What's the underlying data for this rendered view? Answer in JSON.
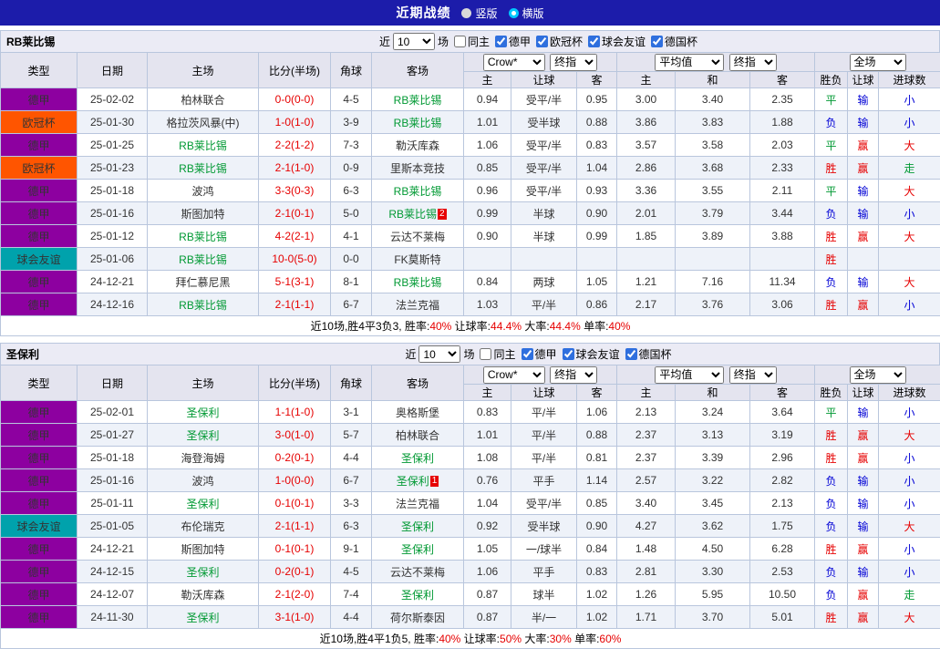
{
  "topbar": {
    "title": "近期战绩",
    "options": [
      {
        "label": "竖版",
        "selected": false
      },
      {
        "label": "横版",
        "selected": true
      }
    ]
  },
  "filter_labels": {
    "near": "近",
    "games": "场"
  },
  "table_header": {
    "type": "类型",
    "date": "日期",
    "home": "主场",
    "score": "比分(半场)",
    "corner": "角球",
    "away": "客场",
    "dd_company": "Crow*",
    "dd_final": "终指",
    "dd_average": "平均值",
    "dd_final2": "终指",
    "dd_fulltime": "全场",
    "ah_cols": [
      "主",
      "让球",
      "客"
    ],
    "eu_cols": [
      "主",
      "和",
      "客"
    ],
    "res_cols": [
      "胜负",
      "让球",
      "进球数"
    ]
  },
  "league_colors": {
    "德甲": "#8d00a0",
    "欧冠杯": "#ff5500",
    "球会友谊": "#00a2ac"
  },
  "colors": {
    "score": "#e60000",
    "subject_team": "#009933"
  },
  "result_colors": {
    "red": "#e60000",
    "blue": "#0000d5",
    "green": "#009933"
  },
  "result_color_map": {
    "胜": "red",
    "赢": "red",
    "大": "red",
    "负": "blue",
    "输": "blue",
    "小": "blue",
    "平": "green",
    "走": "green"
  },
  "sections": [
    {
      "team": "RB莱比锡",
      "filter": {
        "count": "10",
        "options": [
          {
            "label": "同主",
            "checked": false
          },
          {
            "label": "德甲",
            "checked": true
          },
          {
            "label": "欧冠杯",
            "checked": true
          },
          {
            "label": "球会友谊",
            "checked": true
          },
          {
            "label": "德国杯",
            "checked": true
          }
        ]
      },
      "rows": [
        {
          "league": "德甲",
          "date": "25-02-02",
          "home": "柏林联合",
          "home_subject": false,
          "score": "0-0(0-0)",
          "corner": "4-5",
          "away": "RB莱比锡",
          "away_subject": true,
          "ah": [
            "0.94",
            "受平/半",
            "0.95"
          ],
          "eu": [
            "3.00",
            "3.40",
            "2.35"
          ],
          "res": [
            "平",
            "输",
            "小"
          ]
        },
        {
          "league": "欧冠杯",
          "date": "25-01-30",
          "home": "格拉茨风暴(中)",
          "home_subject": false,
          "score": "1-0(1-0)",
          "corner": "3-9",
          "away": "RB莱比锡",
          "away_subject": true,
          "ah": [
            "1.01",
            "受半球",
            "0.88"
          ],
          "eu": [
            "3.86",
            "3.83",
            "1.88"
          ],
          "res": [
            "负",
            "输",
            "小"
          ]
        },
        {
          "league": "德甲",
          "date": "25-01-25",
          "home": "RB莱比锡",
          "home_subject": true,
          "score": "2-2(1-2)",
          "corner": "7-3",
          "away": "勒沃库森",
          "away_subject": false,
          "ah": [
            "1.06",
            "受平/半",
            "0.83"
          ],
          "eu": [
            "3.57",
            "3.58",
            "2.03"
          ],
          "res": [
            "平",
            "赢",
            "大"
          ]
        },
        {
          "league": "欧冠杯",
          "date": "25-01-23",
          "home": "RB莱比锡",
          "home_subject": true,
          "score": "2-1(1-0)",
          "corner": "0-9",
          "away": "里斯本竞技",
          "away_subject": false,
          "ah": [
            "0.85",
            "受平/半",
            "1.04"
          ],
          "eu": [
            "2.86",
            "3.68",
            "2.33"
          ],
          "res": [
            "胜",
            "赢",
            "走"
          ]
        },
        {
          "league": "德甲",
          "date": "25-01-18",
          "home": "波鸿",
          "home_subject": false,
          "score": "3-3(0-3)",
          "corner": "6-3",
          "away": "RB莱比锡",
          "away_subject": true,
          "ah": [
            "0.96",
            "受平/半",
            "0.93"
          ],
          "eu": [
            "3.36",
            "3.55",
            "2.11"
          ],
          "res": [
            "平",
            "输",
            "大"
          ]
        },
        {
          "league": "德甲",
          "date": "25-01-16",
          "home": "斯图加特",
          "home_subject": false,
          "score": "2-1(0-1)",
          "corner": "5-0",
          "away": "RB莱比锡",
          "away_subject": true,
          "away_redcard": "2",
          "ah": [
            "0.99",
            "半球",
            "0.90"
          ],
          "eu": [
            "2.01",
            "3.79",
            "3.44"
          ],
          "res": [
            "负",
            "输",
            "小"
          ]
        },
        {
          "league": "德甲",
          "date": "25-01-12",
          "home": "RB莱比锡",
          "home_subject": true,
          "score": "4-2(2-1)",
          "corner": "4-1",
          "away": "云达不莱梅",
          "away_subject": false,
          "ah": [
            "0.90",
            "半球",
            "0.99"
          ],
          "eu": [
            "1.85",
            "3.89",
            "3.88"
          ],
          "res": [
            "胜",
            "赢",
            "大"
          ]
        },
        {
          "league": "球会友谊",
          "date": "25-01-06",
          "home": "RB莱比锡",
          "home_subject": true,
          "score": "10-0(5-0)",
          "corner": "0-0",
          "away": "FK莫斯特",
          "away_subject": false,
          "ah": [
            "",
            "",
            ""
          ],
          "eu": [
            "",
            "",
            ""
          ],
          "res": [
            "胜",
            "",
            ""
          ]
        },
        {
          "league": "德甲",
          "date": "24-12-21",
          "home": "拜仁慕尼黑",
          "home_subject": false,
          "score": "5-1(3-1)",
          "corner": "8-1",
          "away": "RB莱比锡",
          "away_subject": true,
          "ah": [
            "0.84",
            "两球",
            "1.05"
          ],
          "eu": [
            "1.21",
            "7.16",
            "11.34"
          ],
          "res": [
            "负",
            "输",
            "大"
          ]
        },
        {
          "league": "德甲",
          "date": "24-12-16",
          "home": "RB莱比锡",
          "home_subject": true,
          "score": "2-1(1-1)",
          "corner": "6-7",
          "away": "法兰克福",
          "away_subject": false,
          "ah": [
            "1.03",
            "平/半",
            "0.86"
          ],
          "eu": [
            "2.17",
            "3.76",
            "3.06"
          ],
          "res": [
            "胜",
            "赢",
            "小"
          ]
        }
      ],
      "summary": {
        "prefix": "近10场,胜4平3负3,",
        "stats": [
          {
            "label": "胜率:",
            "value": "40%"
          },
          {
            "label": "让球率:",
            "value": "44.4%"
          },
          {
            "label": "大率:",
            "value": "44.4%"
          },
          {
            "label": "单率:",
            "value": "40%"
          }
        ]
      }
    },
    {
      "team": "圣保利",
      "filter": {
        "count": "10",
        "options": [
          {
            "label": "同主",
            "checked": false
          },
          {
            "label": "德甲",
            "checked": true
          },
          {
            "label": "球会友谊",
            "checked": true
          },
          {
            "label": "德国杯",
            "checked": true
          }
        ]
      },
      "rows": [
        {
          "league": "德甲",
          "date": "25-02-01",
          "home": "圣保利",
          "home_subject": true,
          "score": "1-1(1-0)",
          "corner": "3-1",
          "away": "奥格斯堡",
          "away_subject": false,
          "ah": [
            "0.83",
            "平/半",
            "1.06"
          ],
          "eu": [
            "2.13",
            "3.24",
            "3.64"
          ],
          "res": [
            "平",
            "输",
            "小"
          ]
        },
        {
          "league": "德甲",
          "date": "25-01-27",
          "home": "圣保利",
          "home_subject": true,
          "score": "3-0(1-0)",
          "corner": "5-7",
          "away": "柏林联合",
          "away_subject": false,
          "ah": [
            "1.01",
            "平/半",
            "0.88"
          ],
          "eu": [
            "2.37",
            "3.13",
            "3.19"
          ],
          "res": [
            "胜",
            "赢",
            "大"
          ]
        },
        {
          "league": "德甲",
          "date": "25-01-18",
          "home": "海登海姆",
          "home_subject": false,
          "score": "0-2(0-1)",
          "corner": "4-4",
          "away": "圣保利",
          "away_subject": true,
          "ah": [
            "1.08",
            "平/半",
            "0.81"
          ],
          "eu": [
            "2.37",
            "3.39",
            "2.96"
          ],
          "res": [
            "胜",
            "赢",
            "小"
          ]
        },
        {
          "league": "德甲",
          "date": "25-01-16",
          "home": "波鸿",
          "home_subject": false,
          "score": "1-0(0-0)",
          "corner": "6-7",
          "away": "圣保利",
          "away_subject": true,
          "away_redcard": "1",
          "ah": [
            "0.76",
            "平手",
            "1.14"
          ],
          "eu": [
            "2.57",
            "3.22",
            "2.82"
          ],
          "res": [
            "负",
            "输",
            "小"
          ]
        },
        {
          "league": "德甲",
          "date": "25-01-11",
          "home": "圣保利",
          "home_subject": true,
          "score": "0-1(0-1)",
          "corner": "3-3",
          "away": "法兰克福",
          "away_subject": false,
          "ah": [
            "1.04",
            "受平/半",
            "0.85"
          ],
          "eu": [
            "3.40",
            "3.45",
            "2.13"
          ],
          "res": [
            "负",
            "输",
            "小"
          ]
        },
        {
          "league": "球会友谊",
          "date": "25-01-05",
          "home": "布伦瑞克",
          "home_subject": false,
          "score": "2-1(1-1)",
          "corner": "6-3",
          "away": "圣保利",
          "away_subject": true,
          "ah": [
            "0.92",
            "受半球",
            "0.90"
          ],
          "eu": [
            "4.27",
            "3.62",
            "1.75"
          ],
          "res": [
            "负",
            "输",
            "大"
          ]
        },
        {
          "league": "德甲",
          "date": "24-12-21",
          "home": "斯图加特",
          "home_subject": false,
          "score": "0-1(0-1)",
          "corner": "9-1",
          "away": "圣保利",
          "away_subject": true,
          "ah": [
            "1.05",
            "一/球半",
            "0.84"
          ],
          "eu": [
            "1.48",
            "4.50",
            "6.28"
          ],
          "res": [
            "胜",
            "赢",
            "小"
          ]
        },
        {
          "league": "德甲",
          "date": "24-12-15",
          "home": "圣保利",
          "home_subject": true,
          "score": "0-2(0-1)",
          "corner": "4-5",
          "away": "云达不莱梅",
          "away_subject": false,
          "ah": [
            "1.06",
            "平手",
            "0.83"
          ],
          "eu": [
            "2.81",
            "3.30",
            "2.53"
          ],
          "res": [
            "负",
            "输",
            "小"
          ]
        },
        {
          "league": "德甲",
          "date": "24-12-07",
          "home": "勒沃库森",
          "home_subject": false,
          "score": "2-1(2-0)",
          "corner": "7-4",
          "away": "圣保利",
          "away_subject": true,
          "ah": [
            "0.87",
            "球半",
            "1.02"
          ],
          "eu": [
            "1.26",
            "5.95",
            "10.50"
          ],
          "res": [
            "负",
            "赢",
            "走"
          ]
        },
        {
          "league": "德甲",
          "date": "24-11-30",
          "home": "圣保利",
          "home_subject": true,
          "score": "3-1(1-0)",
          "corner": "4-4",
          "away": "荷尔斯泰因",
          "away_subject": false,
          "ah": [
            "0.87",
            "半/一",
            "1.02"
          ],
          "eu": [
            "1.71",
            "3.70",
            "5.01"
          ],
          "res": [
            "胜",
            "赢",
            "大"
          ]
        }
      ],
      "summary": {
        "prefix": "近10场,胜4平1负5,",
        "stats": [
          {
            "label": "胜率:",
            "value": "40%"
          },
          {
            "label": "让球率:",
            "value": "50%"
          },
          {
            "label": "大率:",
            "value": "30%"
          },
          {
            "label": "单率:",
            "value": "60%"
          }
        ]
      }
    }
  ]
}
